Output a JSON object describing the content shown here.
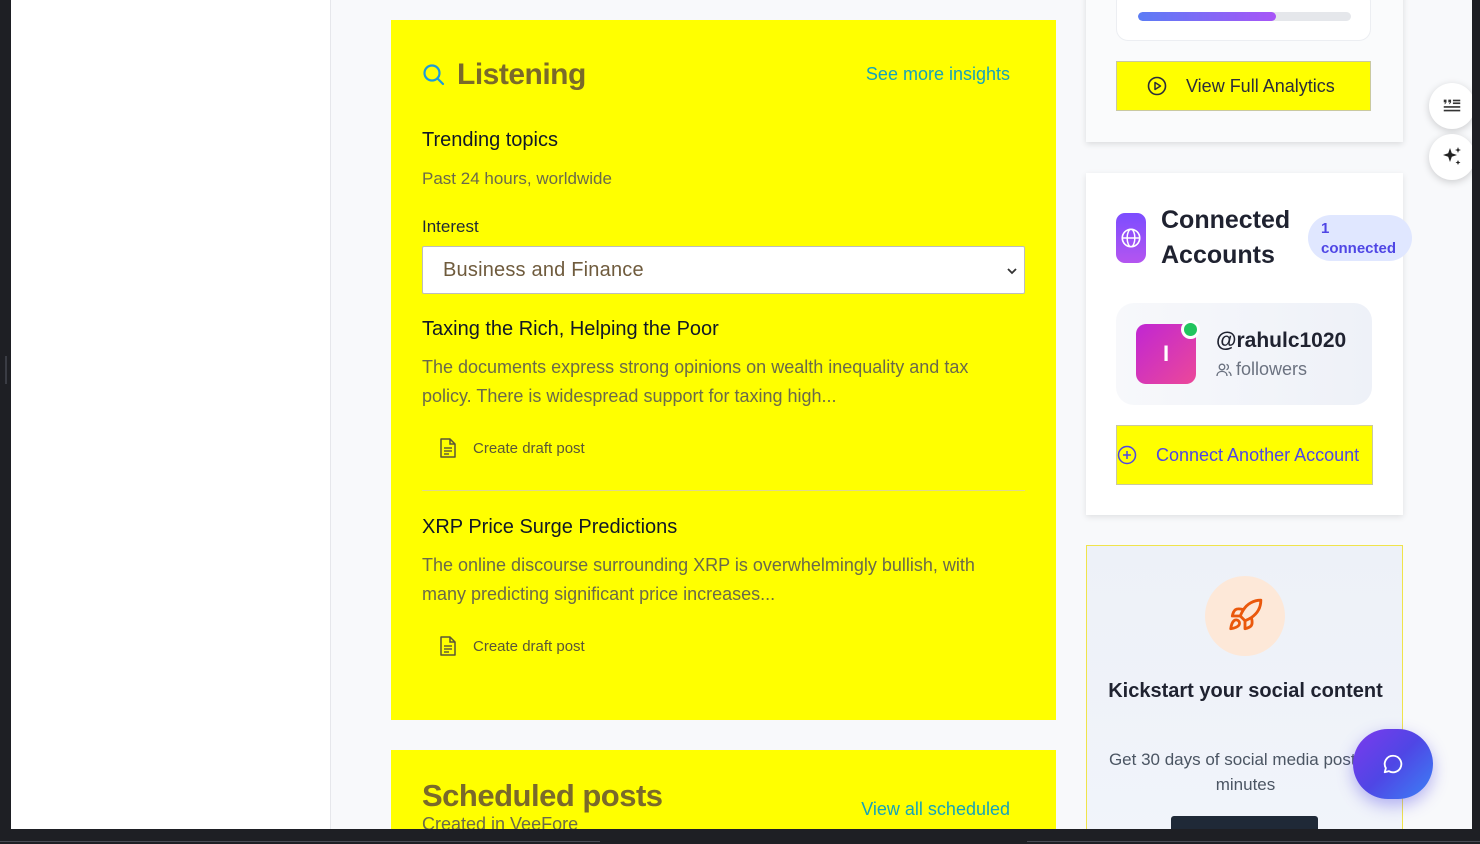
{
  "listening": {
    "title": "Listening",
    "see_more": "See more insights",
    "trending_title": "Trending topics",
    "trending_sub": "Past 24 hours, worldwide",
    "interest_label": "Interest",
    "interest_selected": "Business and Finance",
    "topics": [
      {
        "title": "Taxing the Rich, Helping the Poor",
        "desc": "The documents express strong opinions on wealth inequality and tax policy. There is widespread support for taxing high...",
        "action": "Create draft post"
      },
      {
        "title": "XRP Price Surge Predictions",
        "desc": "The online discourse surrounding XRP is overwhelmingly bullish, with many predicting significant price increases...",
        "action": "Create draft post"
      }
    ]
  },
  "scheduled": {
    "title": "Scheduled posts",
    "sub": "Created in VeeFore",
    "view_all": "View all scheduled"
  },
  "analytics": {
    "progress": 0.65,
    "view_full": "View Full Analytics"
  },
  "accounts": {
    "title": "Connected Accounts",
    "badge": "1 connected",
    "handle": "@rahulc1020",
    "avatar_letter": "I",
    "followers_label": "followers",
    "connect_another": "Connect Another Account"
  },
  "kickstart": {
    "title": "Kickstart your social content",
    "desc": "Get 30 days of social media posts in minutes"
  },
  "colors": {
    "highlight": "#ffff00",
    "link": "#16a3b8",
    "accent": "#4f46e5"
  }
}
